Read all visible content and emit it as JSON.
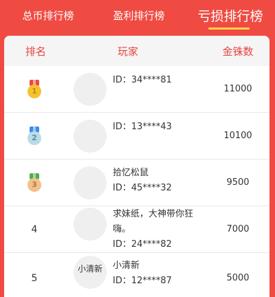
{
  "tabs": [
    {
      "label": "总币排行榜",
      "active": false
    },
    {
      "label": "盈利排行榜",
      "active": false
    },
    {
      "label": "亏损排行榜",
      "active": true
    }
  ],
  "table": {
    "headers": {
      "rank": "排名",
      "player": "玩家",
      "coins": "金铢数"
    },
    "rows": [
      {
        "rank": "1",
        "medal": "gold-medal-icon",
        "avatar_text": "",
        "name": "",
        "id": "ID：34****81",
        "coins": "11000"
      },
      {
        "rank": "2",
        "medal": "silver-medal-icon",
        "avatar_text": "",
        "name": "",
        "id": "ID：13****43",
        "coins": "10100"
      },
      {
        "rank": "3",
        "medal": "bronze-medal-icon",
        "avatar_text": "",
        "name": "拾忆松鼠",
        "id": "ID：45****32",
        "coins": "9500"
      },
      {
        "rank": "4",
        "medal": "",
        "avatar_text": "",
        "name": "求妹纸，大神带你狂嗨。",
        "id": "ID：24****82",
        "coins": "7000"
      },
      {
        "rank": "5",
        "medal": "",
        "avatar_text": "小清新",
        "name": "小清新",
        "id": "ID：12****87",
        "coins": "5000"
      }
    ]
  },
  "colors": {
    "background": "#ef4b43",
    "active_tab_underline": "#ffd34d",
    "header_text": "#e64540",
    "gold": "#f5c330",
    "silver": "#b9dce8",
    "bronze": "#f2c28a"
  }
}
